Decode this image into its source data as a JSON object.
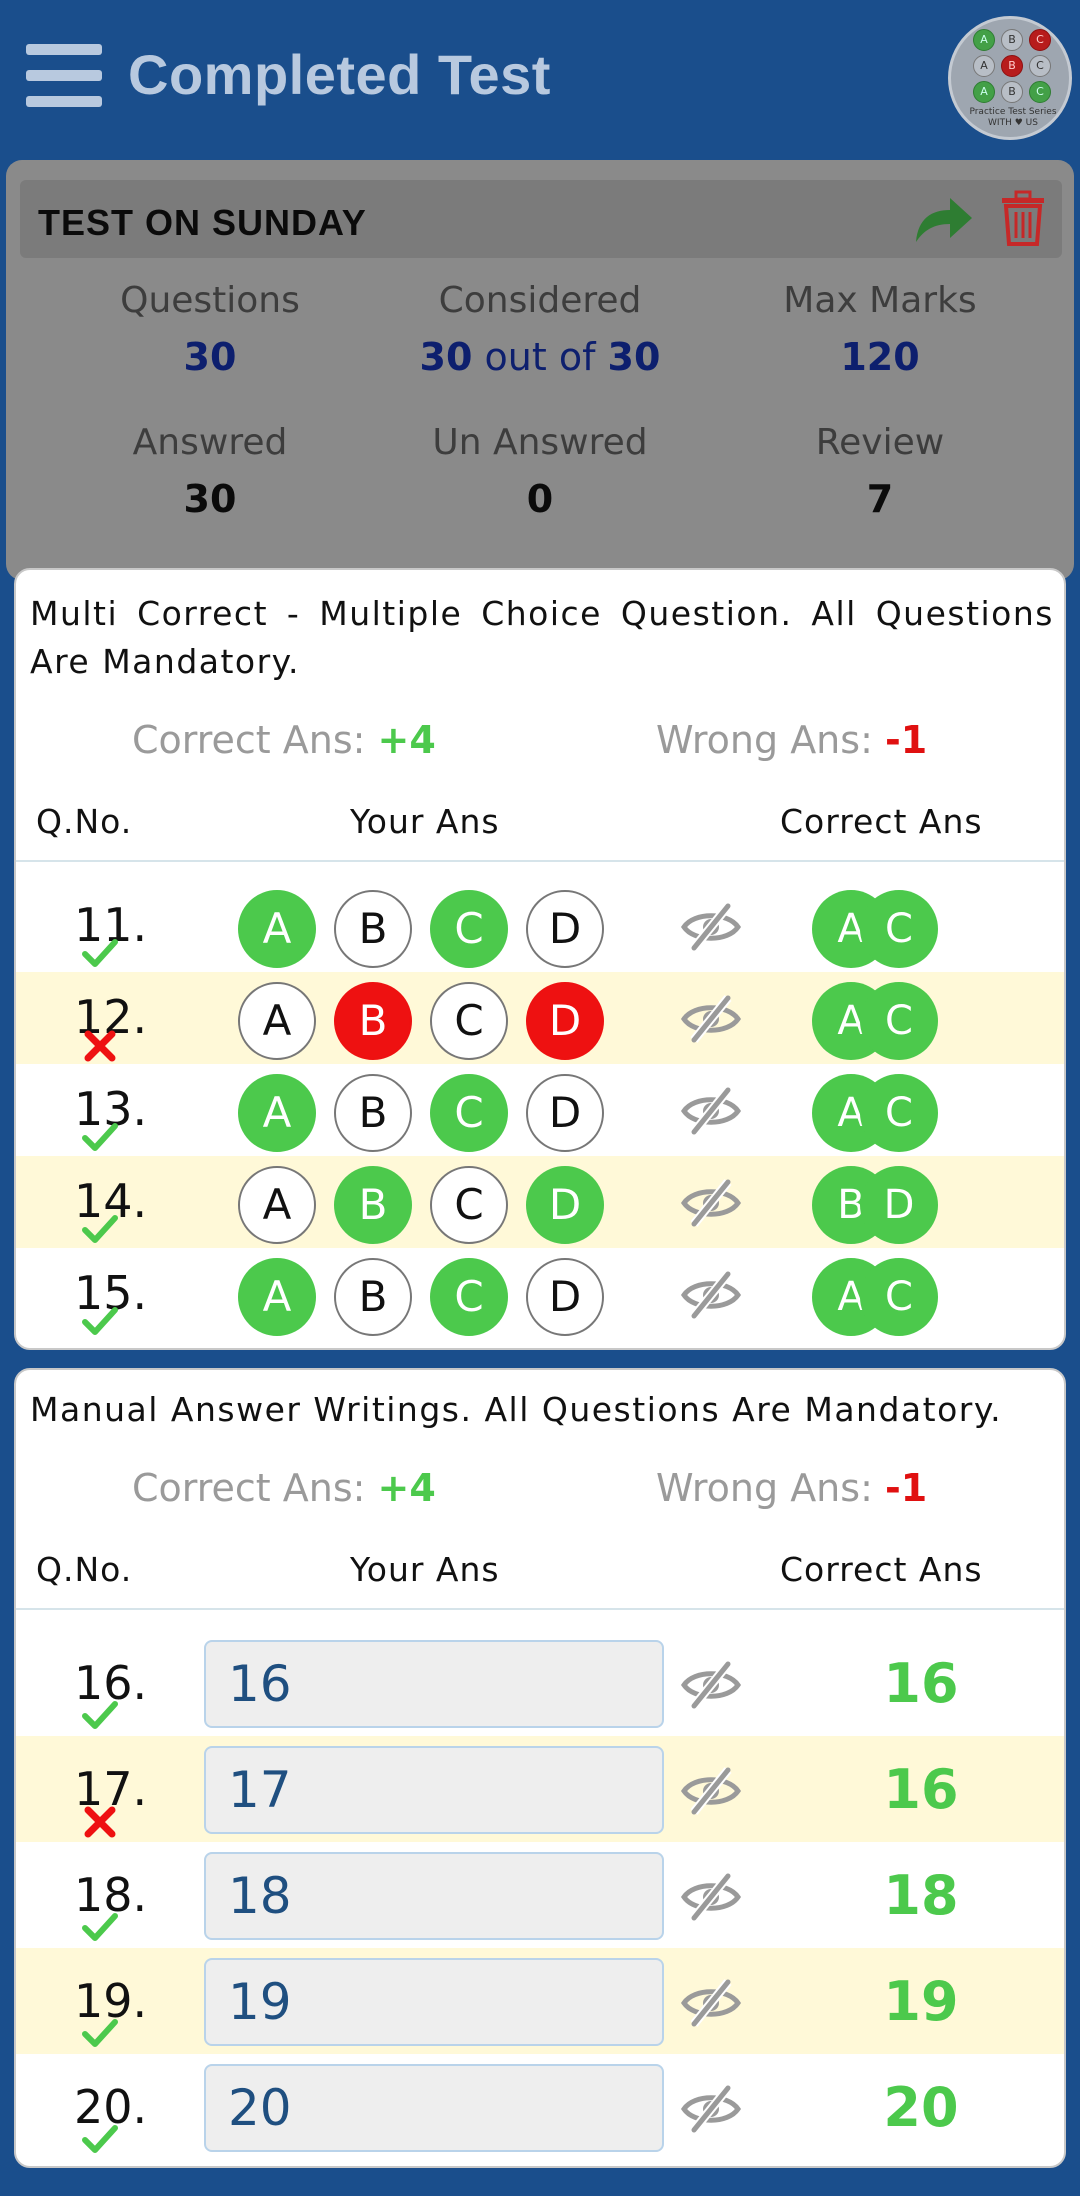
{
  "header": {
    "title": "Completed Test"
  },
  "logo": {
    "dots": [
      {
        "t": "A",
        "c": "g"
      },
      {
        "t": "B",
        "c": ""
      },
      {
        "t": "C",
        "c": "r"
      },
      {
        "t": "A",
        "c": ""
      },
      {
        "t": "B",
        "c": "r"
      },
      {
        "t": "C",
        "c": ""
      },
      {
        "t": "A",
        "c": "g"
      },
      {
        "t": "B",
        "c": ""
      },
      {
        "t": "C",
        "c": "g"
      }
    ],
    "line1": "Practice Test Series",
    "line2": "WITH ♥ US"
  },
  "summary": {
    "test_name": "TEST ON SUNDAY",
    "questions_label": "Questions",
    "questions_value": "30",
    "considered_label": "Considered",
    "considered_a": "30",
    "considered_mid": " out of ",
    "considered_b": "30",
    "max_marks_label": "Max Marks",
    "max_marks_value": "120",
    "answered_label": "Answred",
    "answered_value": "30",
    "unanswered_label": "Un Answred",
    "unanswered_value": "0",
    "review_label": "Review",
    "review_value": "7"
  },
  "section1": {
    "instruction": "Multi Correct - Multiple Choice Question. All Questions Are Mandatory.",
    "correct_label": "Correct Ans: ",
    "correct_value": "+4",
    "wrong_label": "Wrong Ans: ",
    "wrong_value": "-1",
    "col_qno": "Q.No.",
    "col_your": "Your Ans",
    "col_correct": "Correct Ans",
    "rows": [
      {
        "q": "11.",
        "ok": true,
        "opts": [
          [
            "A",
            "g"
          ],
          [
            "B",
            ""
          ],
          [
            "C",
            "g"
          ],
          [
            "D",
            ""
          ]
        ],
        "correct": [
          "A",
          "C"
        ]
      },
      {
        "q": "12.",
        "ok": false,
        "opts": [
          [
            "A",
            ""
          ],
          [
            "B",
            "r"
          ],
          [
            "C",
            ""
          ],
          [
            "D",
            "r"
          ]
        ],
        "correct": [
          "A",
          "C"
        ]
      },
      {
        "q": "13.",
        "ok": true,
        "opts": [
          [
            "A",
            "g"
          ],
          [
            "B",
            ""
          ],
          [
            "C",
            "g"
          ],
          [
            "D",
            ""
          ]
        ],
        "correct": [
          "A",
          "C"
        ]
      },
      {
        "q": "14.",
        "ok": true,
        "opts": [
          [
            "A",
            ""
          ],
          [
            "B",
            "g"
          ],
          [
            "C",
            ""
          ],
          [
            "D",
            "g"
          ]
        ],
        "correct": [
          "B",
          "D"
        ]
      },
      {
        "q": "15.",
        "ok": true,
        "opts": [
          [
            "A",
            "g"
          ],
          [
            "B",
            ""
          ],
          [
            "C",
            "g"
          ],
          [
            "D",
            ""
          ]
        ],
        "correct": [
          "A",
          "C"
        ]
      }
    ]
  },
  "section2": {
    "instruction": "Manual Answer Writings. All Questions Are Mandatory.",
    "correct_label": "Correct Ans: ",
    "correct_value": "+4",
    "wrong_label": "Wrong Ans: ",
    "wrong_value": "-1",
    "col_qno": "Q.No.",
    "col_your": "Your Ans",
    "col_correct": "Correct Ans",
    "rows": [
      {
        "q": "16.",
        "ok": true,
        "ans": "16",
        "correct": "16"
      },
      {
        "q": "17.",
        "ok": false,
        "ans": "17",
        "correct": "16"
      },
      {
        "q": "18.",
        "ok": true,
        "ans": "18",
        "correct": "18"
      },
      {
        "q": "19.",
        "ok": true,
        "ans": "19",
        "correct": "19"
      },
      {
        "q": "20.",
        "ok": true,
        "ans": "20",
        "correct": "20"
      }
    ]
  }
}
